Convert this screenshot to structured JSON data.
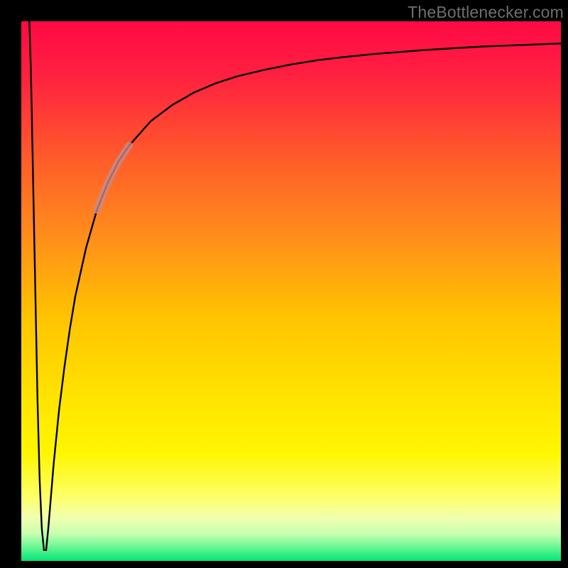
{
  "watermark": "TheBottlenecker.com",
  "chart_data": {
    "type": "line",
    "title": "",
    "xlabel": "",
    "ylabel": "",
    "xlim": [
      0,
      100
    ],
    "ylim": [
      0,
      100
    ],
    "background_gradient": {
      "stops": [
        {
          "offset": 0.0,
          "color": "#ff0a45"
        },
        {
          "offset": 0.1,
          "color": "#ff2040"
        },
        {
          "offset": 0.25,
          "color": "#ff5a2a"
        },
        {
          "offset": 0.4,
          "color": "#ff8e1a"
        },
        {
          "offset": 0.55,
          "color": "#ffc400"
        },
        {
          "offset": 0.7,
          "color": "#ffe400"
        },
        {
          "offset": 0.8,
          "color": "#fff600"
        },
        {
          "offset": 0.88,
          "color": "#fdff66"
        },
        {
          "offset": 0.92,
          "color": "#f2ffb0"
        },
        {
          "offset": 0.95,
          "color": "#c7ffb0"
        },
        {
          "offset": 0.975,
          "color": "#66f793"
        },
        {
          "offset": 1.0,
          "color": "#00e676"
        }
      ]
    },
    "series": [
      {
        "name": "bottleneck-curve",
        "stroke": "#000000",
        "stroke_width": 2.4,
        "points": [
          {
            "x": 1.5,
            "y": 100.0
          },
          {
            "x": 1.8,
            "y": 90.0
          },
          {
            "x": 2.2,
            "y": 70.0
          },
          {
            "x": 2.6,
            "y": 50.0
          },
          {
            "x": 3.0,
            "y": 30.0
          },
          {
            "x": 3.4,
            "y": 15.0
          },
          {
            "x": 3.8,
            "y": 6.0
          },
          {
            "x": 4.2,
            "y": 2.0
          },
          {
            "x": 4.6,
            "y": 2.0
          },
          {
            "x": 5.0,
            "y": 6.0
          },
          {
            "x": 6.0,
            "y": 18.0
          },
          {
            "x": 7.0,
            "y": 28.0
          },
          {
            "x": 8.0,
            "y": 36.0
          },
          {
            "x": 9.0,
            "y": 43.0
          },
          {
            "x": 10.0,
            "y": 49.0
          },
          {
            "x": 12.0,
            "y": 58.0
          },
          {
            "x": 14.0,
            "y": 65.0
          },
          {
            "x": 16.0,
            "y": 70.0
          },
          {
            "x": 18.0,
            "y": 74.0
          },
          {
            "x": 20.0,
            "y": 77.0
          },
          {
            "x": 24.0,
            "y": 81.5
          },
          {
            "x": 28.0,
            "y": 84.5
          },
          {
            "x": 32.0,
            "y": 86.8
          },
          {
            "x": 36.0,
            "y": 88.5
          },
          {
            "x": 40.0,
            "y": 89.8
          },
          {
            "x": 45.0,
            "y": 91.0
          },
          {
            "x": 50.0,
            "y": 92.0
          },
          {
            "x": 55.0,
            "y": 92.8
          },
          {
            "x": 60.0,
            "y": 93.4
          },
          {
            "x": 65.0,
            "y": 93.9
          },
          {
            "x": 70.0,
            "y": 94.3
          },
          {
            "x": 75.0,
            "y": 94.7
          },
          {
            "x": 80.0,
            "y": 95.0
          },
          {
            "x": 85.0,
            "y": 95.3
          },
          {
            "x": 90.0,
            "y": 95.5
          },
          {
            "x": 95.0,
            "y": 95.7
          },
          {
            "x": 100.0,
            "y": 95.9
          }
        ]
      },
      {
        "name": "highlight-segment",
        "stroke": "rgba(200,140,140,0.78)",
        "stroke_width": 10,
        "points": [
          {
            "x": 14.0,
            "y": 65.0
          },
          {
            "x": 15.0,
            "y": 67.7
          },
          {
            "x": 16.0,
            "y": 70.0
          },
          {
            "x": 17.0,
            "y": 72.1
          },
          {
            "x": 18.0,
            "y": 74.0
          },
          {
            "x": 19.0,
            "y": 75.5
          },
          {
            "x": 20.0,
            "y": 77.0
          }
        ]
      }
    ]
  }
}
